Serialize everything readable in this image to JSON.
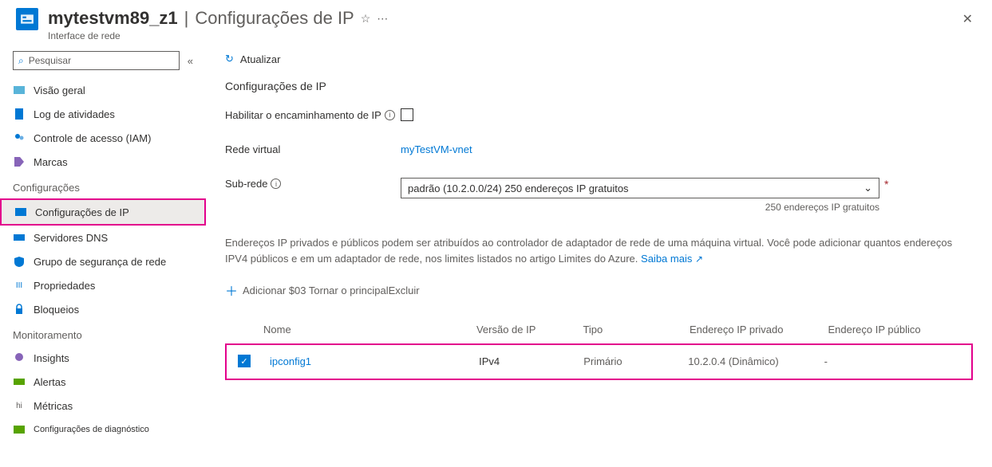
{
  "header": {
    "resource_name": "mytestvm89_z1",
    "separator": "|",
    "blade_title": "Configurações de IP",
    "subtitle": "Interface de rede"
  },
  "sidebar": {
    "search_placeholder": "Pesquisar",
    "items_top": [
      {
        "label": "Visão geral"
      },
      {
        "label": "Log de atividades"
      },
      {
        "label": "Controle de acesso (IAM)"
      },
      {
        "label": "Marcas"
      }
    ],
    "section_config": "Configurações",
    "items_config": [
      {
        "label": "Configurações de IP"
      },
      {
        "label": "Servidores DNS"
      },
      {
        "label": "Grupo de segurança de rede"
      },
      {
        "label": "Propriedades"
      },
      {
        "label": "Bloqueios"
      }
    ],
    "section_monitor": "Monitoramento",
    "items_monitor": [
      {
        "label": "Insights"
      },
      {
        "label": "Alertas"
      },
      {
        "label": "Métricas"
      },
      {
        "label": "Configurações de diagnóstico"
      }
    ]
  },
  "toolbar": {
    "refresh": "Atualizar"
  },
  "form": {
    "section_title": "Configurações de IP",
    "ip_forward_label": "Habilitar o encaminhamento de IP",
    "vnet_label": "Rede virtual",
    "vnet_value": "myTestVM-vnet",
    "subnet_label": "Sub-rede",
    "subnet_value": "padrão (10.2.0.0/24) 250 endereços IP gratuitos",
    "subnet_hint": "250 endereços IP gratuitos"
  },
  "desc": {
    "text": "Endereços IP privados e públicos podem ser atribuídos ao controlador de adaptador de rede de uma máquina virtual. Você pode adicionar quantos endereços IPV4 públicos e em um adaptador de rede, nos limites listados no artigo Limites do Azure.",
    "learn_more": "Saiba mais"
  },
  "actions": {
    "add": "Adicionar",
    "make_primary": "Tornar o principal",
    "delete": "Excluir",
    "line": "Adicionar $03 Tornar o principalExcluir"
  },
  "table": {
    "headers": {
      "name": "Nome",
      "version": "Versão de IP",
      "type": "Tipo",
      "private": "Endereço IP privado",
      "public": "Endereço IP público"
    },
    "rows": [
      {
        "name": "ipconfig1",
        "version": "IPv4",
        "type": "Primário",
        "private": "10.2.0.4 (Dinâmico)",
        "public": "-"
      }
    ]
  },
  "hi_prefix": "hi ",
  "iii_prefix": "III "
}
